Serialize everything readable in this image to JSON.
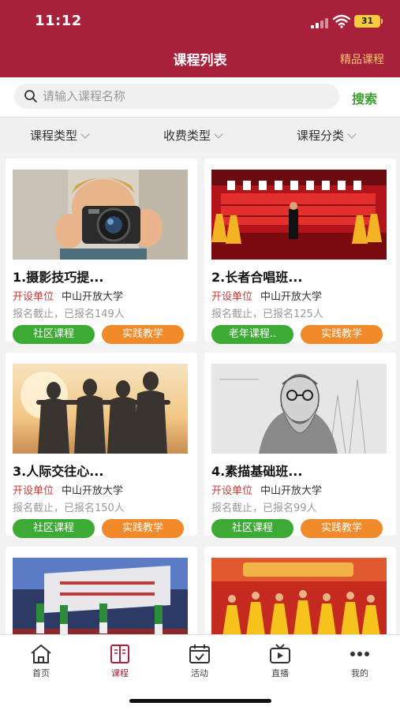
{
  "status_bar": {
    "time": "11:12",
    "battery": "31"
  },
  "header": {
    "title": "课程列表",
    "right_link": "精品课程"
  },
  "search": {
    "placeholder": "请输入课程名称",
    "button": "搜索"
  },
  "filters": [
    {
      "label": "课程类型"
    },
    {
      "label": "收费类型"
    },
    {
      "label": "课程分类"
    }
  ],
  "courses": [
    {
      "title": "1.摄影技巧提...",
      "unit_label": "开设单位",
      "unit": "中山开放大学",
      "enroll": "报名截止，已报名149人",
      "tag1": "社区课程",
      "tag2": "实践教学"
    },
    {
      "title": "2.长者合唱班...",
      "unit_label": "开设单位",
      "unit": "中山开放大学",
      "enroll": "报名截止，已报名125人",
      "tag1": "老年课程..",
      "tag2": "实践教学"
    },
    {
      "title": "3.人际交往心...",
      "unit_label": "开设单位",
      "unit": "中山开放大学",
      "enroll": "报名截止，已报名150人",
      "tag1": "社区课程",
      "tag2": "实践教学"
    },
    {
      "title": "4.素描基础班...",
      "unit_label": "开设单位",
      "unit": "中山开放大学",
      "enroll": "报名截止，已报名99人",
      "tag1": "社区课程",
      "tag2": "实践教学"
    },
    {
      "title": "",
      "unit_label": "",
      "unit": "",
      "enroll": "",
      "tag1": "",
      "tag2": ""
    },
    {
      "title": "",
      "unit_label": "",
      "unit": "",
      "enroll": "",
      "tag1": "",
      "tag2": ""
    }
  ],
  "tabbar": [
    {
      "label": "首页",
      "icon": "home-icon"
    },
    {
      "label": "课程",
      "icon": "book-icon",
      "active": true
    },
    {
      "label": "活动",
      "icon": "calendar-check-icon"
    },
    {
      "label": "直播",
      "icon": "live-tv-icon"
    },
    {
      "label": "我的",
      "icon": "more-dots-icon"
    }
  ],
  "colors": {
    "brand": "#a8213a",
    "accent_green": "#3daa35",
    "accent_orange": "#f08a2a",
    "link_gold": "#f7c178"
  }
}
